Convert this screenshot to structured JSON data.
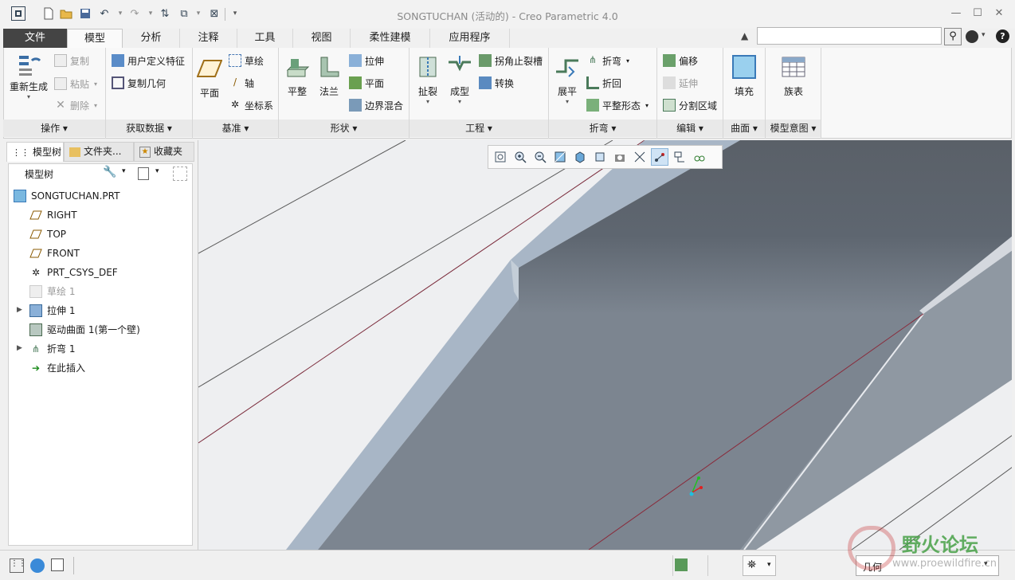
{
  "window": {
    "title": "SONGTUCHAN (活动的) - Creo Parametric 4.0"
  },
  "tabs": [
    "文件",
    "模型",
    "分析",
    "注释",
    "工具",
    "视图",
    "柔性建模",
    "应用程序"
  ],
  "ribbon": {
    "operations": {
      "regenerate": "重新生成",
      "copy": "复制",
      "paste": "粘贴",
      "delete": "删除",
      "group": "操作"
    },
    "get_data": {
      "udf": "用户定义特征",
      "copy_geom": "复制几何",
      "group": "获取数据"
    },
    "datum": {
      "plane": "平面",
      "sketch": "草绘",
      "axis": "轴",
      "csys": "坐标系",
      "group": "基准"
    },
    "shapes": {
      "flat": "平整",
      "flange": "法兰",
      "extrude": "拉伸",
      "planar": "平面",
      "blend": "边界混合",
      "group": "形状"
    },
    "engineering": {
      "rip": "扯裂",
      "form": "成型",
      "corner_relief": "拐角止裂槽",
      "convert": "转换",
      "group": "工程"
    },
    "bends": {
      "unbend": "展平",
      "bend": "折弯",
      "bend_back": "折回",
      "flat_pattern": "平整形态",
      "group": "折弯"
    },
    "editing": {
      "offset": "偏移",
      "extend": "延伸",
      "split": "分割区域",
      "group": "编辑"
    },
    "surfaces": {
      "fill": "填充",
      "group": "曲面"
    },
    "model_intent": {
      "family_table": "族表",
      "group": "模型意图"
    }
  },
  "left_panel": {
    "tabs": [
      "模型树",
      "文件夹...",
      "收藏夹"
    ],
    "header": "模型树",
    "items": [
      {
        "label": "SONGTUCHAN.PRT",
        "icon": "part-icon"
      },
      {
        "label": "RIGHT",
        "icon": "datum-plane-icon"
      },
      {
        "label": "TOP",
        "icon": "datum-plane-icon"
      },
      {
        "label": "FRONT",
        "icon": "datum-plane-icon"
      },
      {
        "label": "PRT_CSYS_DEF",
        "icon": "csys-icon"
      },
      {
        "label": "草绘 1",
        "icon": "sketch-icon"
      },
      {
        "label": "拉伸 1",
        "icon": "extrude-icon"
      },
      {
        "label": "驱动曲面 1(第一个壁)",
        "icon": "wall-icon"
      },
      {
        "label": "折弯 1",
        "icon": "bend-icon"
      },
      {
        "label": "在此插入",
        "icon": "insert-arrow-icon"
      }
    ]
  },
  "status": {
    "filter": "几何"
  },
  "watermark": {
    "name": "野火论坛",
    "url": "www.proewildfire.cn"
  }
}
